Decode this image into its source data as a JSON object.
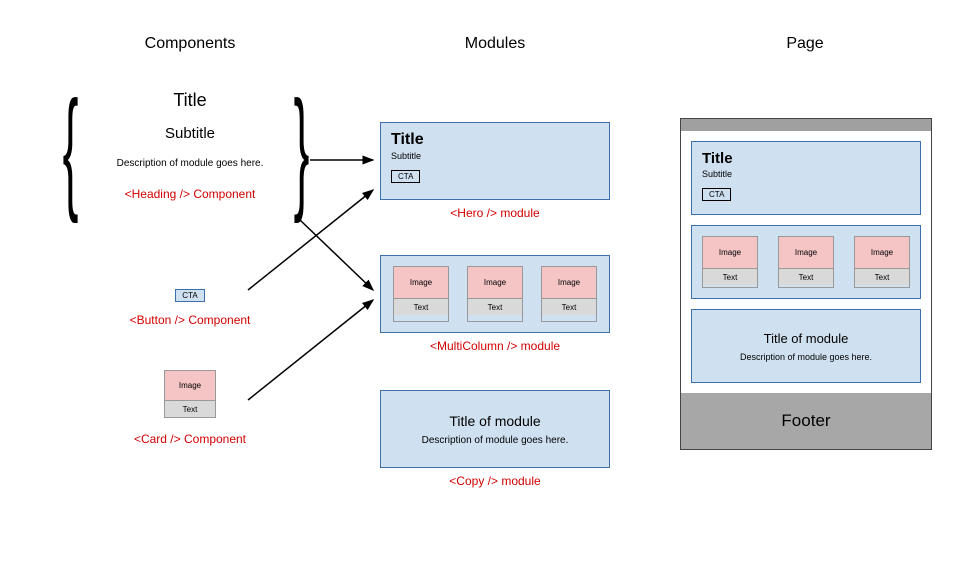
{
  "headers": {
    "components": "Components",
    "modules": "Modules",
    "page": "Page"
  },
  "components": {
    "heading": {
      "title": "Title",
      "subtitle": "Subtitle",
      "description": "Description of module goes here.",
      "label": "<Heading /> Component"
    },
    "button": {
      "cta": "CTA",
      "label": "<Button /> Component"
    },
    "card": {
      "image": "Image",
      "text": "Text",
      "label": "<Card /> Component"
    }
  },
  "modules": {
    "hero": {
      "title": "Title",
      "subtitle": "Subtitle",
      "cta": "CTA",
      "label": "<Hero /> module"
    },
    "multi": {
      "cards": [
        {
          "image": "Image",
          "text": "Text"
        },
        {
          "image": "Image",
          "text": "Text"
        },
        {
          "image": "Image",
          "text": "Text"
        }
      ],
      "label": "<MultiColumn /> module"
    },
    "copy": {
      "title": "Title of module",
      "description": "Description of module goes here.",
      "label": "<Copy /> module"
    }
  },
  "page": {
    "hero": {
      "title": "Title",
      "subtitle": "Subtitle",
      "cta": "CTA"
    },
    "multi": {
      "cards": [
        {
          "image": "Image",
          "text": "Text"
        },
        {
          "image": "Image",
          "text": "Text"
        },
        {
          "image": "Image",
          "text": "Text"
        }
      ]
    },
    "copy": {
      "title": "Title of module",
      "description": "Description of module goes here."
    },
    "footer": "Footer"
  }
}
